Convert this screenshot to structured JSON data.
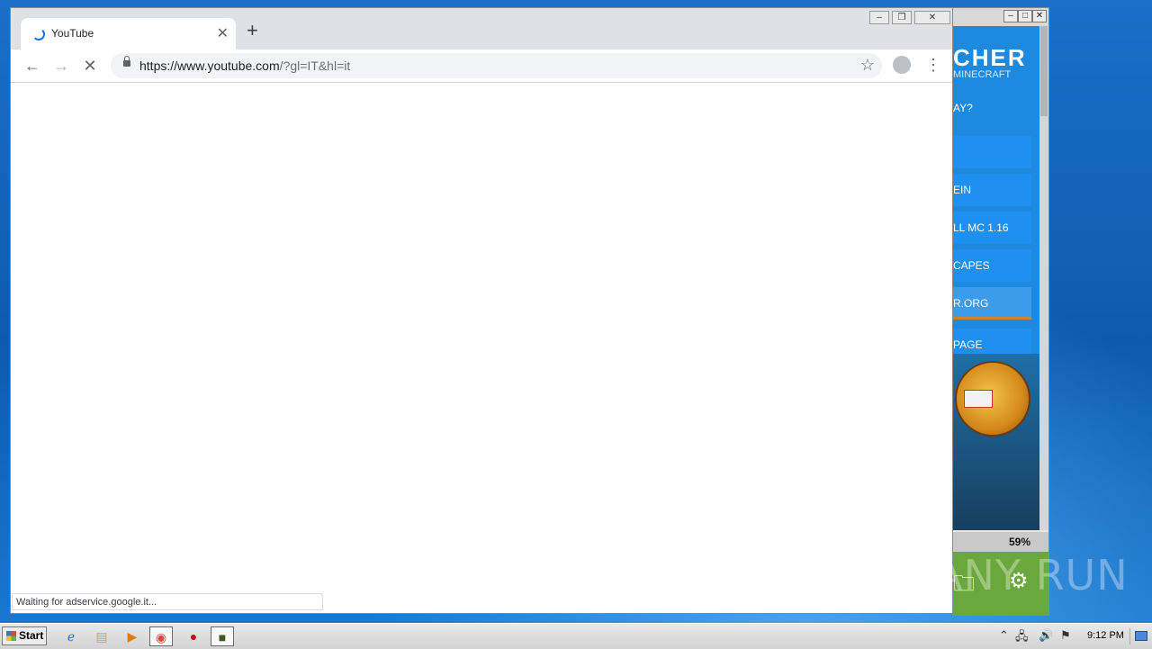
{
  "launcher": {
    "logo_text": "CHER",
    "subtitle": "MINECRAFT",
    "question": "AY?",
    "menu": [
      "",
      "EIN",
      "LL MC 1.16",
      "CAPES",
      "R.ORG",
      "PAGE"
    ],
    "progress": "59%",
    "progress_value": 0.59
  },
  "chrome": {
    "tab_title": "YouTube",
    "url_host": "https://www.youtube.com",
    "url_rest": "/?gl=IT&hl=it",
    "status_text": "Waiting for adservice.google.it...",
    "accent_color": "#1a73e8"
  },
  "taskbar": {
    "start_label": "Start",
    "clock": "9:12 PM"
  },
  "watermark": "ANY RUN"
}
